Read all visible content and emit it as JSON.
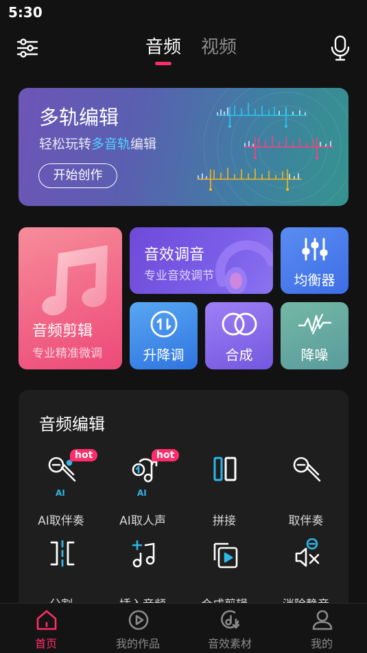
{
  "status_bar": {
    "time": "5:30"
  },
  "top_nav": {
    "tabs": [
      {
        "label": "音频",
        "active": true
      },
      {
        "label": "视频",
        "active": false
      }
    ]
  },
  "banner": {
    "title": "多轨编辑",
    "subtitle_pre": "轻松玩转",
    "subtitle_highlight": "多音轨",
    "subtitle_post": "编辑",
    "button": "开始创作"
  },
  "cards": {
    "edit": {
      "title": "音频剪辑",
      "subtitle": "专业精准微调"
    },
    "effect": {
      "title": "音效调音",
      "subtitle": "专业音效调节"
    },
    "eq": {
      "title": "均衡器"
    },
    "pitch": {
      "title": "升降调"
    },
    "mix": {
      "title": "合成"
    },
    "noise": {
      "title": "降噪"
    }
  },
  "panel": {
    "title": "音频编辑",
    "tools": [
      {
        "label": "AI取伴奏",
        "badge": "hot",
        "ai": "AI",
        "icon": "ai-mic-icon"
      },
      {
        "label": "AI取人声",
        "badge": "hot",
        "ai": "AI",
        "icon": "ai-voice-icon"
      },
      {
        "label": "拼接",
        "icon": "splice-icon"
      },
      {
        "label": "取伴奏",
        "icon": "mic-minus-icon"
      },
      {
        "label": "分割",
        "icon": "split-icon"
      },
      {
        "label": "插入音频",
        "icon": "insert-audio-icon"
      },
      {
        "label": "合成剪辑",
        "icon": "merge-clip-icon"
      },
      {
        "label": "消除静音",
        "icon": "remove-silence-icon"
      }
    ]
  },
  "bottom_nav": {
    "items": [
      {
        "label": "首页",
        "active": true,
        "icon": "home-icon"
      },
      {
        "label": "我的作品",
        "active": false,
        "icon": "play-circle-icon"
      },
      {
        "label": "音效素材",
        "active": false,
        "icon": "music-disc-icon"
      },
      {
        "label": "我的",
        "active": false,
        "icon": "user-icon"
      }
    ]
  },
  "colors": {
    "accent": "#ff2d6a",
    "ai_blue": "#2fb7e8",
    "background": "#121212"
  }
}
